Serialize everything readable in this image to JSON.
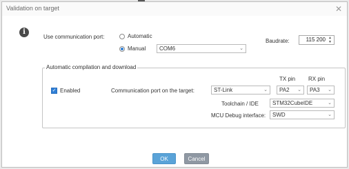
{
  "window": {
    "title": "Validation on target"
  },
  "comm": {
    "label": "Use communication port:",
    "automatic_label": "Automatic",
    "manual_label": "Manual",
    "selected": "Manual",
    "port_value": "COM6",
    "baudrate_label": "Baudrate:",
    "baudrate_value": "115 200"
  },
  "group": {
    "title": "Automatic compilation and download",
    "enabled_label": "Enabled",
    "enabled_checked": true,
    "target_port_label": "Communication port on the target:",
    "target_port_value": "ST-Link",
    "tx_header": "TX pin",
    "rx_header": "RX pin",
    "tx_value": "PA2",
    "rx_value": "PA3",
    "toolchain_label": "Toolchain / IDE",
    "toolchain_value": "STM32CubeIDE",
    "debug_label": "MCU Debug interface:",
    "debug_value": "SWD"
  },
  "buttons": {
    "ok": "OK",
    "cancel": "Cancel"
  },
  "colors": {
    "accent": "#2f7fd6",
    "ok_button": "#5aa3d8",
    "cancel_button": "#8f98a3"
  }
}
